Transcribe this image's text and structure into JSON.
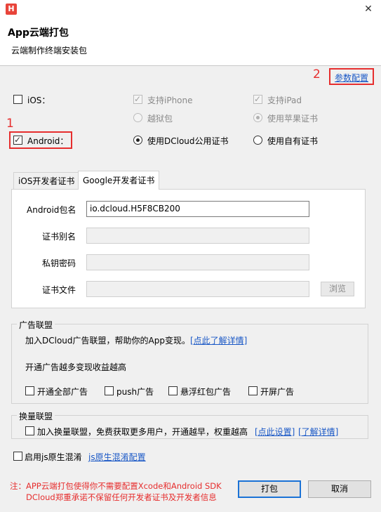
{
  "window": {
    "logo_letter": "H",
    "close_glyph": "✕"
  },
  "header": {
    "title": "App云端打包",
    "subtitle": "云端制作终端安装包"
  },
  "annotations": {
    "marker_1": "1",
    "marker_2": "2"
  },
  "params_link": "参数配置",
  "platforms": {
    "ios_label": "iOS：",
    "ios_checked": false,
    "android_label": "Android：",
    "android_checked": true,
    "support_iphone": "支持iPhone",
    "support_ipad": "支持iPad",
    "jailbreak": "越狱包",
    "apple_cert": "使用苹果证书",
    "dcloud_cert": "使用DCloud公用证书",
    "own_cert": "使用自有证书",
    "check_glyph": "✓"
  },
  "tabs": [
    {
      "label": "iOS开发者证书",
      "active": false
    },
    {
      "label": "Google开发者证书",
      "active": true
    }
  ],
  "cert_form": {
    "package_label": "Android包名",
    "package_value": "io.dcloud.H5F8CB200",
    "alias_label": "证书别名",
    "key_label": "私钥密码",
    "file_label": "证书文件",
    "browse_label": "浏览"
  },
  "ad_union": {
    "title": "广告联盟",
    "desc": "加入DCloud广告联盟，帮助你的App变现。",
    "detail_link": "[点此了解详情]",
    "tip": "开通广告越多变现收益越高",
    "options": [
      "开通全部广告",
      "push广告",
      "悬浮红包广告",
      "开屏广告"
    ]
  },
  "traffic_union": {
    "title": "换量联盟",
    "join_label": "加入换量联盟，免费获取更多用户，开通越早，权重越高",
    "setup_link": "[点此设置]",
    "detail_link": "[了解详情]"
  },
  "obfuscation": {
    "label": "启用js原生混淆",
    "config_link": "js原生混淆配置"
  },
  "footer": {
    "note_line1": "注：APP云端打包使得你不需要配置Xcode和Android SDK",
    "note_line2": "DCloud郑重承诺不保留任何开发者证书及开发者信息",
    "pack_button": "打包",
    "cancel_button": "取消"
  },
  "colors": {
    "annotation_red": "#e62e2e",
    "link_blue": "#1a58c6",
    "primary_border": "#1a72d6"
  }
}
